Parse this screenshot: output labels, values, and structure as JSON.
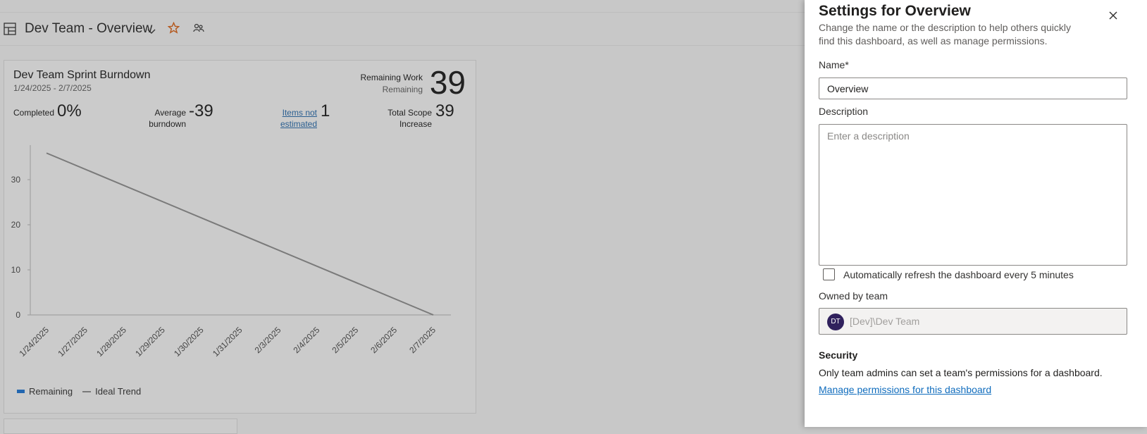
{
  "header": {
    "dashboard_title": "Dev Team - Overview"
  },
  "widget": {
    "title": "Dev Team Sprint Burndown",
    "dates": "1/24/2025 - 2/7/2025",
    "remaining_work_label": "Remaining Work",
    "remaining_label": "Remaining",
    "remaining_value": "39",
    "completed_label": "Completed",
    "completed_value": "0%",
    "avg_burndown_label_1": "Average",
    "avg_burndown_label_2": "burndown",
    "avg_burndown_value": "-39",
    "items_not_estimated_1": "Items not",
    "items_not_estimated_2": "estimated",
    "items_not_estimated_value": "1",
    "total_scope_label_1": "Total Scope",
    "total_scope_label_2": "Increase",
    "total_scope_value": "39",
    "legend_remaining": "Remaining",
    "legend_ideal": "Ideal Trend"
  },
  "chart_data": {
    "type": "line",
    "x": [
      "1/24/2025",
      "1/27/2025",
      "1/28/2025",
      "1/29/2025",
      "1/30/2025",
      "1/31/2025",
      "2/3/2025",
      "2/4/2025",
      "2/5/2025",
      "2/6/2025",
      "2/7/2025"
    ],
    "y_ticks": [
      0,
      10,
      20,
      30
    ],
    "ylim": [
      0,
      37.5
    ],
    "series": [
      {
        "name": "Ideal Trend",
        "x": [
          "1/24/2025",
          "2/7/2025"
        ],
        "values": [
          35.9,
          0
        ],
        "color": "#7a7a7a"
      },
      {
        "name": "Remaining",
        "values": [],
        "color": "#2367b0"
      }
    ]
  },
  "panel": {
    "title": "Settings for Overview",
    "description": "Change the name or the description to help others quickly find this dashboard, as well as manage permissions.",
    "name_label": "Name*",
    "name_value": "Overview",
    "description_label": "Description",
    "description_placeholder": "Enter a description",
    "auto_refresh_label": "Automatically refresh the dashboard every 5 minutes",
    "auto_refresh_checked": false,
    "owned_by_label": "Owned by team",
    "team_initials": "DT",
    "team_name": "[Dev]\\Dev Team",
    "security_title": "Security",
    "security_text": "Only team admins can set a team's permissions for a dashboard.",
    "manage_permissions_link": "Manage permissions for this dashboard"
  },
  "colors": {
    "accent": "#0f6cbd",
    "avatar_bg": "#30215d",
    "star": "#b4571c"
  }
}
